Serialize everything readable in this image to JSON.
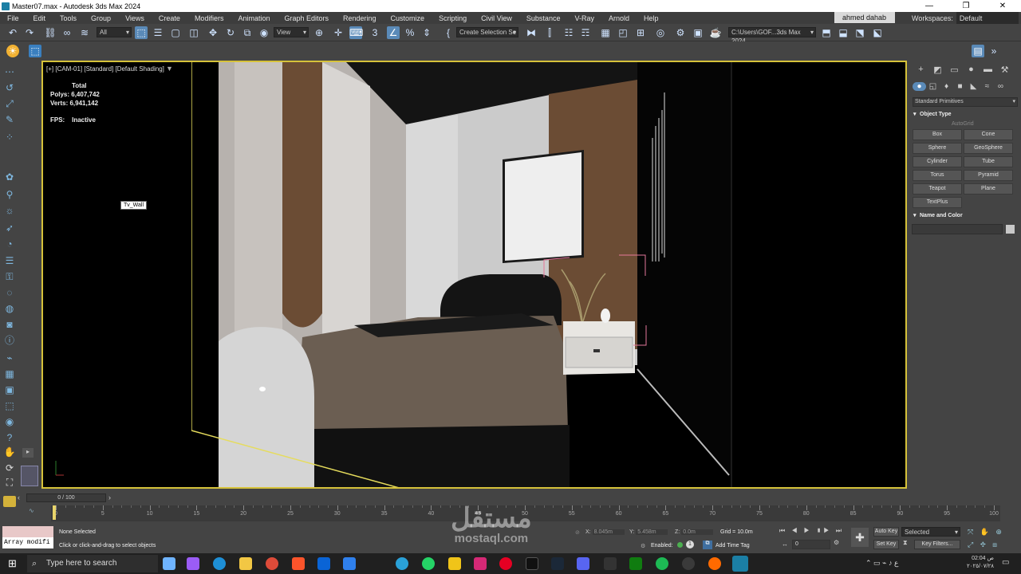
{
  "window": {
    "title": "Master07.max - Autodesk 3ds Max 2024",
    "minimize": "—",
    "maximize": "❐",
    "close": "✕"
  },
  "menu": {
    "items": [
      "File",
      "Edit",
      "Tools",
      "Group",
      "Views",
      "Create",
      "Modifiers",
      "Animation",
      "Graph Editors",
      "Rendering",
      "Customize",
      "Scripting",
      "Civil View",
      "Substance",
      "V-Ray",
      "Arnold",
      "Help"
    ],
    "user": "ahmed dahab",
    "workspaces_label": "Workspaces:",
    "workspace_value": "Default"
  },
  "toolbar": {
    "filter_value": "All",
    "refcoord_value": "View",
    "selection_set_placeholder": "Create Selection Se",
    "path_value": "C:\\Users\\GOF...3ds Max 2024"
  },
  "viewport": {
    "label": "[+] [CAM-01] [Standard] [Default Shading]",
    "stats_header": "Total",
    "polys_label": "Polys:",
    "polys_value": "6,407,742",
    "verts_label": "Verts:",
    "verts_value": "6,941,142",
    "fps_label": "FPS:",
    "fps_value": "Inactive",
    "object_tag": "Tv_Wall"
  },
  "command_panel": {
    "category": "Standard Primitives",
    "object_type_title": "Object Type",
    "autogrid": "AutoGrid",
    "buttons": [
      "Box",
      "Cone",
      "Sphere",
      "GeoSphere",
      "Cylinder",
      "Tube",
      "Torus",
      "Pyramid",
      "Teapot",
      "Plane",
      "TextPlus"
    ],
    "name_color_title": "Name and Color"
  },
  "timeline": {
    "slider": "0 / 100",
    "ticks": [
      "0",
      "5",
      "10",
      "15",
      "20",
      "25",
      "30",
      "35",
      "40",
      "45",
      "50",
      "55",
      "60",
      "65",
      "70",
      "75",
      "80",
      "85",
      "90",
      "95",
      "100"
    ]
  },
  "status": {
    "maxscript_value": "Array modifi",
    "selection": "None Selected",
    "prompt": "Click or click-and-drag to select objects",
    "x_label": "X:",
    "x_value": "8.045m",
    "y_label": "Y:",
    "y_value": "5.458m",
    "z_label": "Z:",
    "z_value": "0.0m",
    "grid": "Grid = 10.0m",
    "enabled_label": "Enabled:",
    "add_time_tag": "Add Time Tag",
    "auto_key": "Auto Key",
    "set_key": "Set Key",
    "selected_value": "Selected",
    "key_filters": "Key Filters...",
    "frame_value": "0"
  },
  "taskbar": {
    "search_placeholder": "Type here to search",
    "time": "02:04 ص",
    "date": "٢٠٢٥/٠٧/٢٨"
  },
  "watermark": {
    "arabic": "مستقل",
    "english": "mostaql.com"
  }
}
